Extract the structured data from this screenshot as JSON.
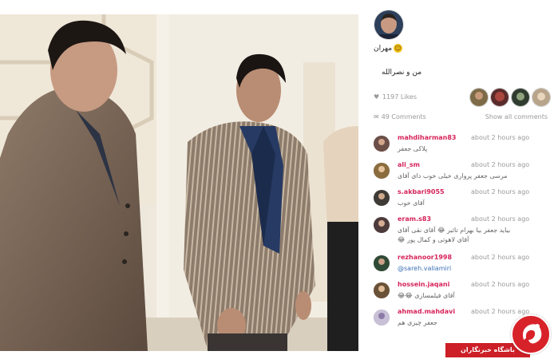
{
  "post": {
    "owner_name": "مهران",
    "owner_emoji": "☺",
    "caption": "من و نصرالله",
    "likes_text": "1197 Likes",
    "comments_text": "49 Comments",
    "show_all": "Show all comments"
  },
  "comments": [
    {
      "user": "mahdiharman83",
      "time": "about 2 hours ago",
      "text": "پلاکی جعفر",
      "text2": ""
    },
    {
      "user": "ali_sm",
      "time": "about 2 hours ago",
      "text": "مرسی جعفر پرواری خیلی خوب دای آقای",
      "text2": ""
    },
    {
      "user": "s.akbari9055",
      "time": "about 2 hours ago",
      "text": "آقای خوب",
      "text2": ""
    },
    {
      "user": "eram.s83",
      "time": "about 2 hours ago",
      "text": "بیاید جعفر بیا بهرام تاثیر 😂 آقای نقی آقای",
      "text2": "😂 آقای لاهوتی و کمال پور"
    },
    {
      "user": "rezhanoor1998",
      "time": "about 2 hours ago",
      "text": "@sareh.valiamiri",
      "text2": ""
    },
    {
      "user": "hossein.jaqani",
      "time": "about 2 hours ago",
      "text": "😂😂 آقای فیلمسازی",
      "text2": ""
    },
    {
      "user": "ahmad.mahdavi",
      "time": "about 2 hours ago",
      "text": "جعفر چیزی هم",
      "text2": ""
    }
  ],
  "colors": {
    "username": "#d6245b",
    "muted": "#999999",
    "logo_red": "#cc1f27"
  },
  "logo": {
    "text": "باشگاه خبرنگاران",
    "icon": "news-agency-logo"
  }
}
